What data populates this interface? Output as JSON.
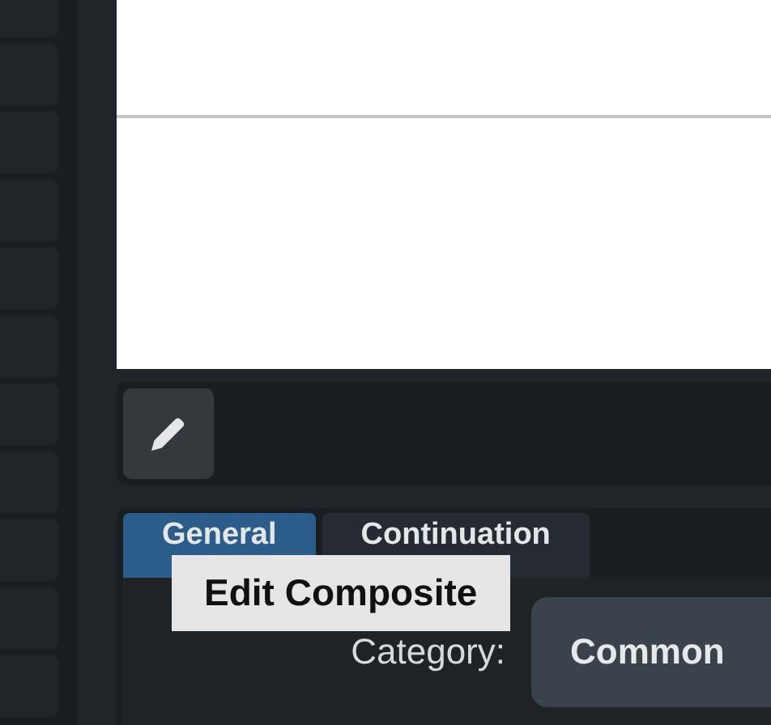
{
  "toolbar": {
    "buttons": [
      {
        "kind": "edit",
        "tooltip": "Edit Composite"
      }
    ]
  },
  "tabs": [
    {
      "label": "General",
      "selected": true
    },
    {
      "label": "Continuation",
      "selected": false
    }
  ],
  "fields": [
    {
      "label": "Category:",
      "value": "Common"
    }
  ]
}
